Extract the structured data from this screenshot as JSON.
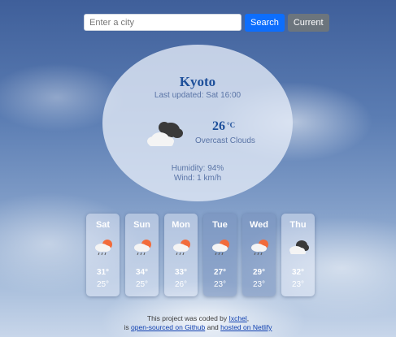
{
  "search": {
    "placeholder": "Enter a city",
    "search_label": "Search",
    "current_label": "Current"
  },
  "current": {
    "city": "Kyoto",
    "last_updated": "Last updated: Sat 16:00",
    "temperature": "26",
    "unit": "°C",
    "description": "Overcast Clouds",
    "humidity": "Humidity: 94%",
    "wind": "Wind: 1 km/h",
    "icon": "overcast-clouds-icon"
  },
  "forecast": [
    {
      "day": "Sat",
      "max": "31°",
      "min": "25°",
      "icon": "sun-rain-icon"
    },
    {
      "day": "Sun",
      "max": "34°",
      "min": "25°",
      "icon": "sun-rain-icon"
    },
    {
      "day": "Mon",
      "max": "33°",
      "min": "26°",
      "icon": "sun-rain-icon"
    },
    {
      "day": "Tue",
      "max": "27°",
      "min": "23°",
      "icon": "sun-rain-icon"
    },
    {
      "day": "Wed",
      "max": "29°",
      "min": "23°",
      "icon": "sun-rain-icon"
    },
    {
      "day": "Thu",
      "max": "32°",
      "min": "23°",
      "icon": "overcast-clouds-icon"
    }
  ],
  "footer": {
    "line1_prefix": "This project was coded by ",
    "author": "Ixchel",
    "line1_suffix": ",",
    "line2_prefix": "is ",
    "github_link": "open-sourced on Github",
    "line2_mid": " and ",
    "netlify_link": "hosted on Netlify"
  },
  "colors": {
    "primary_button": "#0d6efd",
    "secondary_button": "#6c757d",
    "accent_text": "#1d4f9a"
  }
}
